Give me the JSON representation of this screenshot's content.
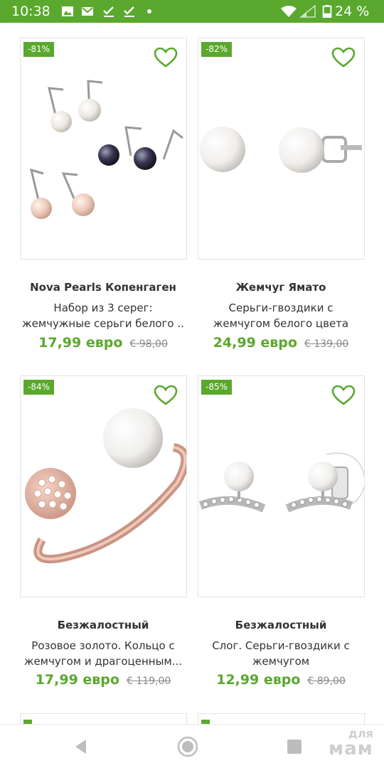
{
  "status_bar": {
    "time": "10:38",
    "battery": "24 %",
    "icons": [
      "image-icon",
      "mail-icon",
      "check-icon",
      "check-icon",
      "dot-icon",
      "wifi-icon",
      "signal-icon",
      "battery-icon"
    ]
  },
  "products": [
    {
      "discount": "-81%",
      "brand": "Nova Pearls Копенгаген",
      "desc_line1": "Набор из 3 серег:",
      "desc_line2": "жемчужные серьги белого ..",
      "price": "17,99 евро",
      "old_price": "€ 98,00"
    },
    {
      "discount": "-82%",
      "brand": "Жемчуг Ямато",
      "desc_line1": "Серьги-гвоздики с",
      "desc_line2": "жемчугом белого цвета",
      "price": "24,99 евро",
      "old_price": "€ 139,00"
    },
    {
      "discount": "-84%",
      "brand": "Безжалостный",
      "desc_line1": "Розовое золото. Кольцо с",
      "desc_line2": "жемчугом и драгоценным...",
      "price": "17,99 евро",
      "old_price": "€ 119,00"
    },
    {
      "discount": "-85%",
      "brand": "Безжалостный",
      "desc_line1": "Слог. Серьги-гвоздики с",
      "desc_line2": "жемчугом",
      "price": "12,99 евро",
      "old_price": "€ 89,00"
    }
  ],
  "watermark": {
    "top": "для",
    "bottom": "мам"
  },
  "colors": {
    "accent": "#5aa82e",
    "border": "#e3e3e3",
    "text": "#333333",
    "muted": "#888888"
  },
  "nav": {
    "icons": [
      "back-icon",
      "home-icon",
      "recents-icon"
    ]
  }
}
